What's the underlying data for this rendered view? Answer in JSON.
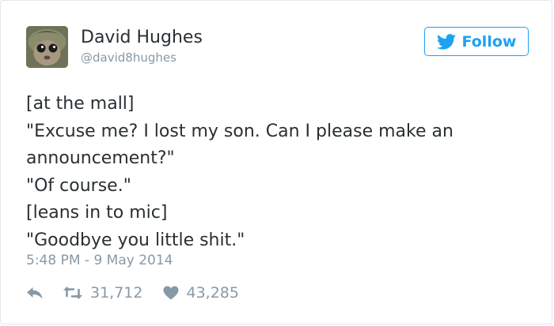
{
  "user": {
    "name": "David Hughes",
    "handle": "@david8hughes"
  },
  "follow_button": {
    "label": "Follow",
    "icon": "twitter-bird-icon"
  },
  "tweet": {
    "lines": [
      "[at the mall]",
      "\"Excuse me? I lost my son. Can I please make an",
      "announcement?\"",
      "\"Of course.\"",
      "[leans in to mic]",
      "\"Goodbye you little shit.\""
    ],
    "timestamp": "5:48 PM - 9 May 2014"
  },
  "actions": {
    "reply_icon": "reply-icon",
    "retweet_icon": "retweet-icon",
    "retweet_count": "31,712",
    "like_icon": "heart-icon",
    "like_count": "43,285"
  },
  "colors": {
    "accent": "#1da1f2",
    "text": "#292f33",
    "muted": "#8899a6",
    "border": "#e1e8ed"
  }
}
